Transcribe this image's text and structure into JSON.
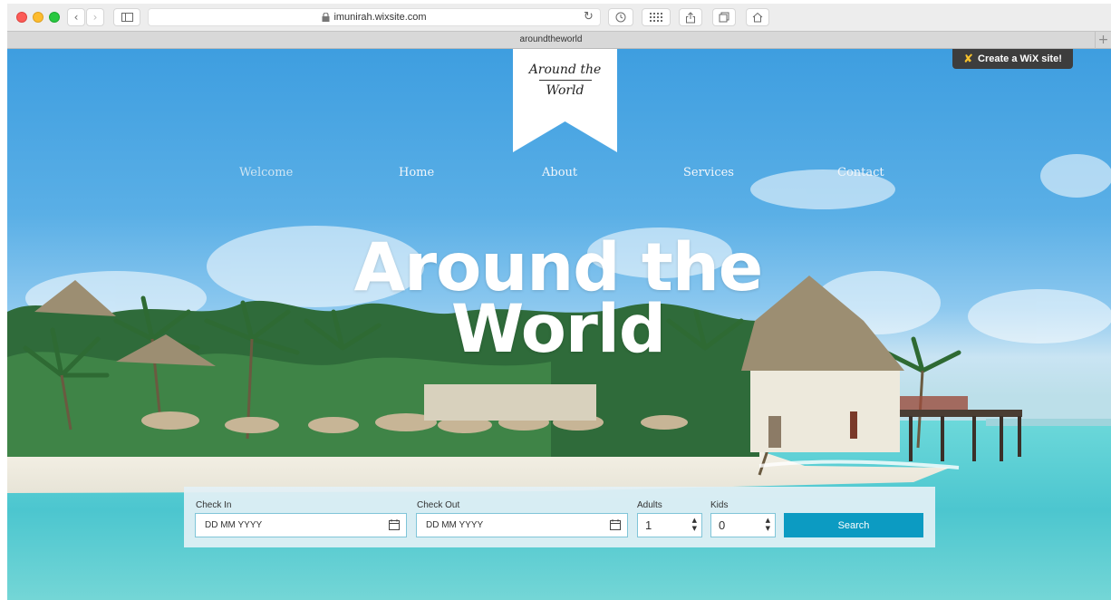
{
  "browser": {
    "url": "imunirah.wixsite.com",
    "tab_title": "aroundtheworld",
    "new_tab_label": "+"
  },
  "site": {
    "logo": {
      "line1": "Around the",
      "line2": "World"
    },
    "wix_badge": "Create a WiX site!",
    "nav": [
      "Welcome",
      "Home",
      "About",
      "Services",
      "Contact"
    ],
    "active_nav": "Welcome",
    "hero_title": {
      "line1": "Around the",
      "line2": "World"
    }
  },
  "booking": {
    "check_in": {
      "label": "Check In",
      "placeholder": "DD MM YYYY"
    },
    "check_out": {
      "label": "Check Out",
      "placeholder": "DD MM YYYY"
    },
    "adults": {
      "label": "Adults",
      "value": "1"
    },
    "kids": {
      "label": "Kids",
      "value": "0"
    },
    "search_label": "Search"
  },
  "icons": {
    "lock": "lock-icon",
    "calendar": "calendar-icon",
    "wix_logo": "wix-x-icon"
  },
  "colors": {
    "search_button": "#0c9bc2",
    "sky": "#3e9ee0",
    "sea": "#5ed0d4",
    "wix_badge": "#3d3d3d"
  }
}
